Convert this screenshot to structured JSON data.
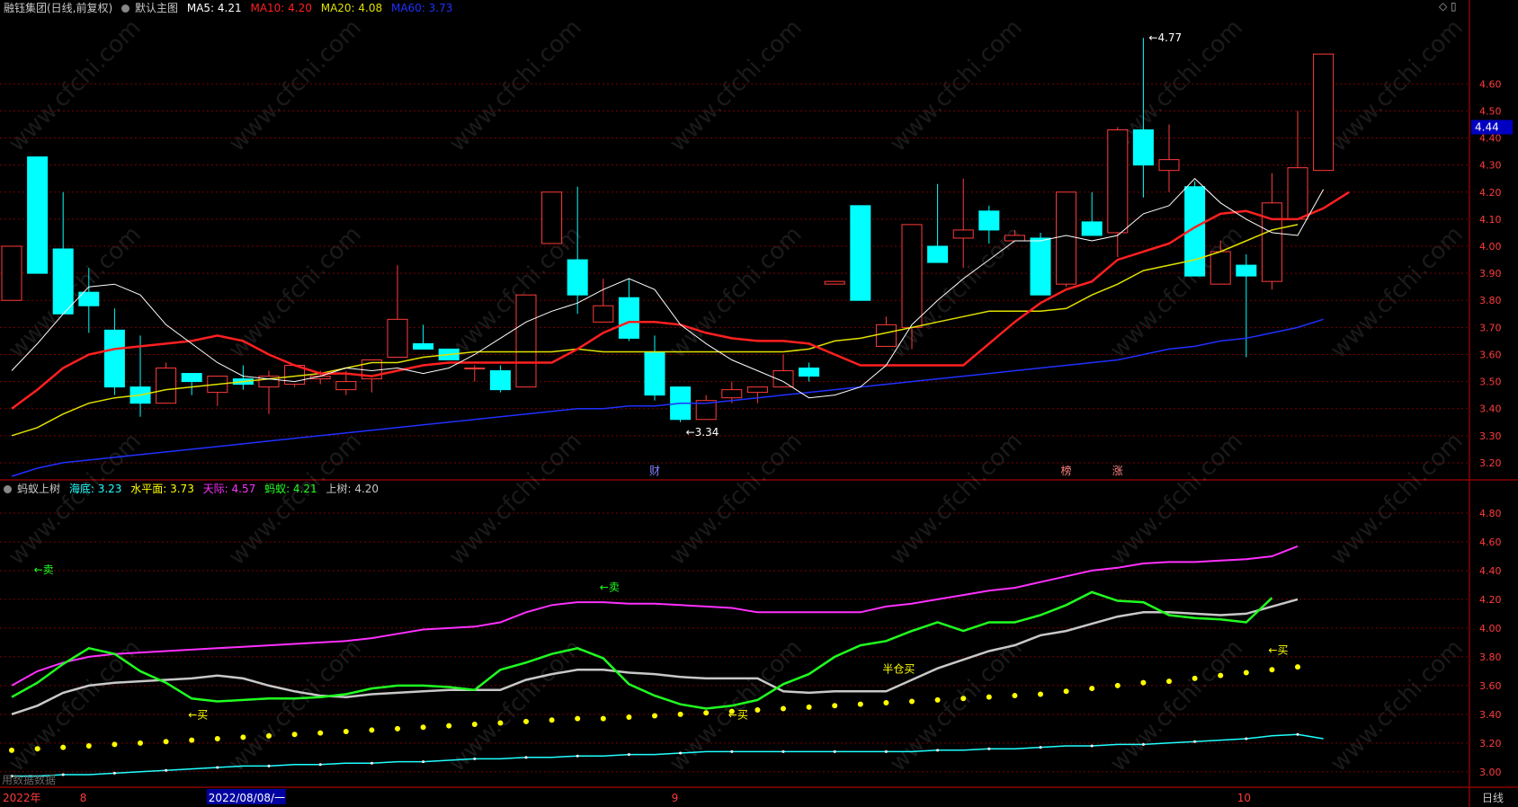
{
  "main_header": {
    "stock": "融钰集团(日线,前复权)",
    "indicator": "默认主图",
    "ma5": "MA5: 4.21",
    "ma10": "MA10: 4.20",
    "ma20": "MA20: 4.08",
    "ma60": "MA60: 3.73"
  },
  "sub_header": {
    "indicator": "蚂蚁上树",
    "sea": "海底: 3.23",
    "level": "水平面: 3.73",
    "sky": "天际: 4.57",
    "ant": "蚂蚁: 4.21",
    "tree": "上树: 4.20"
  },
  "colors": {
    "up": "#ff3b3b",
    "down": "#00ffff",
    "ma5": "#ffffff",
    "ma10": "#ff2020",
    "ma20": "#e0e000",
    "ma60": "#2030ff",
    "sky": "#ff30ff",
    "ant": "#20ff20",
    "tree": "#c8c8c8",
    "level": "#ffff00",
    "sea": "#20ffff",
    "grid": "#7a0000"
  },
  "price_label": "4.44",
  "period_label": "日线",
  "watermark": "www.cfchi.com",
  "bottom_left_note": "用数据数据",
  "x_labels": [
    {
      "i": 0,
      "text": "2022年"
    },
    {
      "i": 3,
      "text": "8"
    },
    {
      "i": 8,
      "text": "2022/08/08/一"
    },
    {
      "i": 26,
      "text": "9"
    },
    {
      "i": 48,
      "text": "10"
    }
  ],
  "markers": [
    {
      "i": 25,
      "text": "财"
    },
    {
      "i": 41,
      "text": "榜"
    },
    {
      "i": 43,
      "text": "涨"
    }
  ],
  "chart_data": [
    {
      "type": "candlestick",
      "title": "默认主图",
      "ylim": [
        3.15,
        4.85
      ],
      "y_ticks": [
        3.2,
        3.3,
        3.4,
        3.5,
        3.6,
        3.7,
        3.8,
        3.9,
        4.0,
        4.1,
        4.2,
        4.3,
        4.4,
        4.5,
        4.6
      ],
      "ohlc": [
        [
          3.8,
          4.0,
          3.8,
          4.0
        ],
        [
          4.33,
          4.33,
          3.9,
          3.9
        ],
        [
          3.99,
          4.2,
          3.75,
          3.75
        ],
        [
          3.83,
          3.92,
          3.68,
          3.78
        ],
        [
          3.69,
          3.77,
          3.45,
          3.48
        ],
        [
          3.48,
          3.67,
          3.37,
          3.42
        ],
        [
          3.42,
          3.57,
          3.42,
          3.55
        ],
        [
          3.53,
          3.53,
          3.45,
          3.5
        ],
        [
          3.46,
          3.52,
          3.41,
          3.52
        ],
        [
          3.51,
          3.56,
          3.47,
          3.49
        ],
        [
          3.48,
          3.54,
          3.38,
          3.52
        ],
        [
          3.49,
          3.56,
          3.48,
          3.56
        ],
        [
          3.51,
          3.54,
          3.49,
          3.52
        ],
        [
          3.47,
          3.54,
          3.45,
          3.5
        ],
        [
          3.51,
          3.58,
          3.46,
          3.58
        ],
        [
          3.59,
          3.93,
          3.59,
          3.73
        ],
        [
          3.64,
          3.71,
          3.63,
          3.62
        ],
        [
          3.62,
          3.62,
          3.58,
          3.58
        ],
        [
          3.55,
          3.56,
          3.5,
          3.55
        ],
        [
          3.54,
          3.56,
          3.46,
          3.47
        ],
        [
          3.48,
          3.82,
          3.48,
          3.82
        ],
        [
          4.01,
          4.2,
          4.01,
          4.2
        ],
        [
          3.95,
          4.22,
          3.75,
          3.82
        ],
        [
          3.72,
          3.88,
          3.72,
          3.78
        ],
        [
          3.81,
          3.88,
          3.65,
          3.66
        ],
        [
          3.61,
          3.67,
          3.43,
          3.45
        ],
        [
          3.48,
          3.48,
          3.35,
          3.36
        ],
        [
          3.36,
          3.45,
          3.36,
          3.43
        ],
        [
          3.44,
          3.5,
          3.42,
          3.47
        ],
        [
          3.46,
          3.48,
          3.42,
          3.48
        ],
        [
          3.48,
          3.6,
          3.48,
          3.54
        ],
        [
          3.55,
          3.57,
          3.5,
          3.52
        ],
        [
          3.86,
          3.86,
          3.86,
          3.87
        ],
        [
          4.15,
          4.15,
          3.8,
          3.8
        ],
        [
          3.63,
          3.74,
          3.63,
          3.71
        ],
        [
          3.7,
          4.08,
          3.62,
          4.08
        ],
        [
          4.0,
          4.23,
          3.94,
          3.94
        ],
        [
          4.03,
          4.25,
          3.92,
          4.06
        ],
        [
          4.13,
          4.15,
          4.01,
          4.06
        ],
        [
          4.02,
          4.06,
          4.02,
          4.04
        ],
        [
          4.03,
          4.05,
          3.82,
          3.82
        ],
        [
          3.86,
          4.2,
          3.85,
          4.2
        ],
        [
          4.09,
          4.2,
          4.05,
          4.04
        ],
        [
          4.05,
          4.44,
          3.96,
          4.43
        ],
        [
          4.43,
          4.77,
          4.18,
          4.3
        ],
        [
          4.28,
          4.45,
          4.2,
          4.32
        ],
        [
          4.22,
          4.24,
          3.89,
          3.89
        ],
        [
          3.86,
          4.02,
          3.86,
          3.98
        ],
        [
          3.93,
          3.97,
          3.59,
          3.89
        ],
        [
          3.87,
          4.27,
          3.84,
          4.16
        ],
        [
          4.1,
          4.5,
          4.1,
          4.29
        ],
        [
          4.28,
          4.71,
          4.28,
          4.71
        ]
      ],
      "series": [
        {
          "name": "MA5",
          "values": [
            3.54,
            3.64,
            3.75,
            3.85,
            3.86,
            3.82,
            3.71,
            3.64,
            3.57,
            3.52,
            3.51,
            3.5,
            3.52,
            3.55,
            3.54,
            3.55,
            3.53,
            3.55,
            3.6,
            3.66,
            3.72,
            3.76,
            3.79,
            3.84,
            3.88,
            3.84,
            3.71,
            3.64,
            3.58,
            3.54,
            3.5,
            3.44,
            3.45,
            3.48,
            3.56,
            3.71,
            3.8,
            3.88,
            3.95,
            4.02,
            4.02,
            4.04,
            4.02,
            4.04,
            4.12,
            4.15,
            4.25,
            4.16,
            4.1,
            4.05,
            4.04,
            4.21
          ]
        },
        {
          "name": "MA10",
          "values": [
            3.4,
            3.47,
            3.55,
            3.6,
            3.62,
            3.63,
            3.64,
            3.65,
            3.67,
            3.65,
            3.6,
            3.56,
            3.53,
            3.53,
            3.52,
            3.54,
            3.56,
            3.57,
            3.57,
            3.57,
            3.57,
            3.57,
            3.62,
            3.68,
            3.72,
            3.72,
            3.71,
            3.68,
            3.66,
            3.65,
            3.65,
            3.64,
            3.6,
            3.56,
            3.56,
            3.56,
            3.56,
            3.56,
            3.64,
            3.72,
            3.79,
            3.84,
            3.87,
            3.95,
            3.98,
            4.01,
            4.07,
            4.12,
            4.13,
            4.1,
            4.1,
            4.14,
            4.2
          ]
        },
        {
          "name": "MA20",
          "values": [
            3.3,
            3.33,
            3.38,
            3.42,
            3.44,
            3.45,
            3.47,
            3.48,
            3.49,
            3.5,
            3.51,
            3.52,
            3.53,
            3.55,
            3.57,
            3.57,
            3.59,
            3.6,
            3.61,
            3.61,
            3.61,
            3.61,
            3.62,
            3.61,
            3.61,
            3.61,
            3.61,
            3.61,
            3.61,
            3.61,
            3.61,
            3.62,
            3.65,
            3.66,
            3.68,
            3.7,
            3.72,
            3.74,
            3.76,
            3.76,
            3.76,
            3.77,
            3.82,
            3.86,
            3.91,
            3.93,
            3.95,
            3.98,
            4.02,
            4.06,
            4.08
          ]
        },
        {
          "name": "MA60",
          "values": [
            3.15,
            3.18,
            3.2,
            3.21,
            3.22,
            3.23,
            3.24,
            3.25,
            3.26,
            3.27,
            3.28,
            3.29,
            3.3,
            3.31,
            3.32,
            3.33,
            3.34,
            3.35,
            3.36,
            3.37,
            3.38,
            3.39,
            3.4,
            3.4,
            3.41,
            3.41,
            3.42,
            3.42,
            3.43,
            3.44,
            3.45,
            3.46,
            3.47,
            3.48,
            3.49,
            3.5,
            3.51,
            3.52,
            3.53,
            3.54,
            3.55,
            3.56,
            3.57,
            3.58,
            3.6,
            3.62,
            3.63,
            3.65,
            3.66,
            3.68,
            3.7,
            3.73
          ]
        }
      ],
      "annotations": [
        {
          "i": 26,
          "price": 3.34,
          "text": "3.34"
        },
        {
          "i": 44,
          "price": 4.77,
          "text": "4.77"
        }
      ]
    },
    {
      "type": "line",
      "title": "蚂蚁上树",
      "ylim": [
        2.93,
        4.9
      ],
      "y_ticks": [
        3.0,
        3.2,
        3.4,
        3.6,
        3.8,
        4.0,
        4.2,
        4.4,
        4.6,
        4.8
      ],
      "series": [
        {
          "name": "天际",
          "values": [
            3.6,
            3.7,
            3.76,
            3.8,
            3.82,
            3.83,
            3.84,
            3.85,
            3.86,
            3.87,
            3.88,
            3.89,
            3.9,
            3.91,
            3.93,
            3.96,
            3.99,
            4.0,
            4.01,
            4.04,
            4.11,
            4.16,
            4.18,
            4.18,
            4.17,
            4.17,
            4.16,
            4.15,
            4.14,
            4.11,
            4.11,
            4.11,
            4.11,
            4.11,
            4.15,
            4.17,
            4.2,
            4.23,
            4.26,
            4.28,
            4.32,
            4.36,
            4.4,
            4.42,
            4.45,
            4.46,
            4.46,
            4.47,
            4.48,
            4.5,
            4.57
          ]
        },
        {
          "name": "蚂蚁",
          "values": [
            3.52,
            3.62,
            3.75,
            3.86,
            3.82,
            3.7,
            3.62,
            3.51,
            3.49,
            3.5,
            3.51,
            3.51,
            3.52,
            3.54,
            3.58,
            3.6,
            3.6,
            3.59,
            3.57,
            3.71,
            3.76,
            3.82,
            3.86,
            3.79,
            3.61,
            3.53,
            3.47,
            3.44,
            3.46,
            3.5,
            3.61,
            3.68,
            3.8,
            3.88,
            3.91,
            3.98,
            4.04,
            3.98,
            4.04,
            4.04,
            4.09,
            4.16,
            4.25,
            4.19,
            4.18,
            4.09,
            4.07,
            4.06,
            4.04,
            4.21
          ]
        },
        {
          "name": "上树",
          "values": [
            3.4,
            3.46,
            3.55,
            3.6,
            3.62,
            3.63,
            3.64,
            3.65,
            3.67,
            3.65,
            3.6,
            3.56,
            3.53,
            3.52,
            3.54,
            3.55,
            3.56,
            3.57,
            3.57,
            3.57,
            3.64,
            3.68,
            3.71,
            3.71,
            3.69,
            3.68,
            3.66,
            3.65,
            3.65,
            3.65,
            3.56,
            3.55,
            3.56,
            3.56,
            3.56,
            3.64,
            3.72,
            3.78,
            3.84,
            3.88,
            3.95,
            3.98,
            4.03,
            4.08,
            4.11,
            4.11,
            4.1,
            4.09,
            4.1,
            4.15,
            4.2
          ]
        },
        {
          "name": "水平面",
          "values": [
            3.15,
            3.16,
            3.17,
            3.18,
            3.19,
            3.2,
            3.21,
            3.22,
            3.23,
            3.24,
            3.25,
            3.26,
            3.27,
            3.28,
            3.29,
            3.3,
            3.31,
            3.32,
            3.33,
            3.34,
            3.35,
            3.36,
            3.37,
            3.37,
            3.38,
            3.39,
            3.4,
            3.41,
            3.42,
            3.43,
            3.44,
            3.45,
            3.46,
            3.47,
            3.48,
            3.49,
            3.5,
            3.51,
            3.52,
            3.53,
            3.54,
            3.56,
            3.58,
            3.6,
            3.62,
            3.63,
            3.65,
            3.67,
            3.69,
            3.71,
            3.73
          ]
        },
        {
          "name": "海底",
          "values": [
            2.97,
            2.97,
            2.98,
            2.98,
            2.99,
            3.0,
            3.01,
            3.02,
            3.03,
            3.04,
            3.04,
            3.05,
            3.05,
            3.06,
            3.06,
            3.07,
            3.07,
            3.08,
            3.09,
            3.09,
            3.1,
            3.1,
            3.11,
            3.11,
            3.12,
            3.12,
            3.13,
            3.14,
            3.14,
            3.14,
            3.14,
            3.14,
            3.14,
            3.14,
            3.14,
            3.14,
            3.15,
            3.15,
            3.16,
            3.16,
            3.17,
            3.18,
            3.18,
            3.19,
            3.19,
            3.2,
            3.21,
            3.22,
            3.23,
            3.25,
            3.26,
            3.23
          ]
        }
      ],
      "signals": [
        {
          "i": 1,
          "value": 4.38,
          "text": "←卖",
          "color": "#20ff20"
        },
        {
          "i": 23,
          "value": 4.26,
          "text": "←卖",
          "color": "#20ff20"
        },
        {
          "i": 7,
          "value": 3.37,
          "text": "←买",
          "color": "#ffff00"
        },
        {
          "i": 28,
          "value": 3.37,
          "text": "←买",
          "color": "#ffff00"
        },
        {
          "i": 34,
          "value": 3.69,
          "text": "半仓买",
          "color": "#ffff00"
        },
        {
          "i": 49,
          "value": 3.82,
          "text": "←买",
          "color": "#ffff00"
        }
      ]
    }
  ]
}
